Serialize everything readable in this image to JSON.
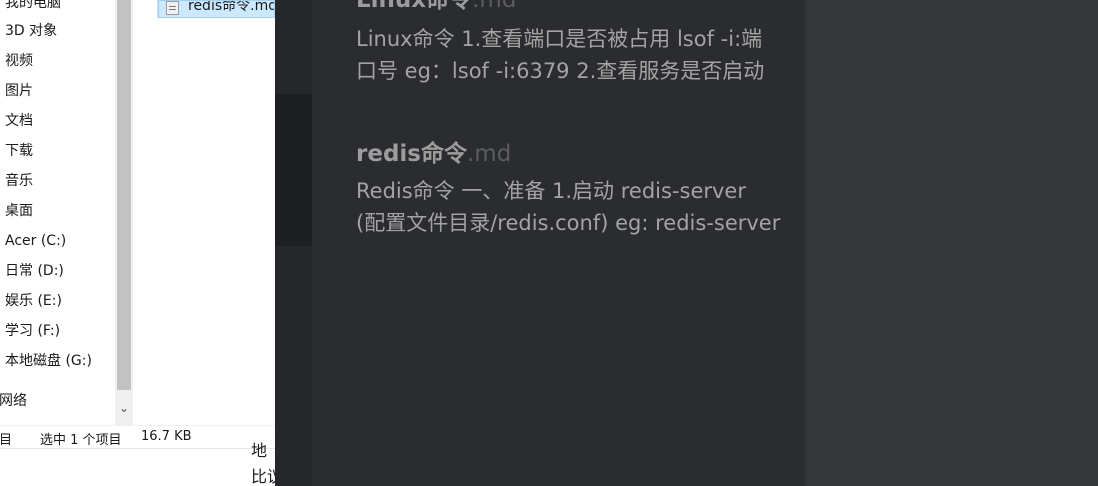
{
  "explorer": {
    "nav_items": [
      {
        "label": "我的电脑",
        "name": "nav-item-this-pc"
      },
      {
        "label": "3D 对象",
        "name": "nav-item-3d-objects"
      },
      {
        "label": "视频",
        "name": "nav-item-videos"
      },
      {
        "label": "图片",
        "name": "nav-item-pictures"
      },
      {
        "label": "文档",
        "name": "nav-item-documents"
      },
      {
        "label": "下载",
        "name": "nav-item-downloads"
      },
      {
        "label": "音乐",
        "name": "nav-item-music"
      },
      {
        "label": "桌面",
        "name": "nav-item-desktop"
      },
      {
        "label": "Acer (C:)",
        "name": "nav-item-drive-c"
      },
      {
        "label": "日常 (D:)",
        "name": "nav-item-drive-d"
      },
      {
        "label": "娱乐 (E:)",
        "name": "nav-item-drive-e"
      },
      {
        "label": "学习 (F:)",
        "name": "nav-item-drive-f"
      },
      {
        "label": "本地磁盘 (G:)",
        "name": "nav-item-drive-g"
      },
      {
        "label": "网络",
        "name": "nav-item-network"
      }
    ],
    "selected_file": "redis命令.md",
    "status": {
      "items_fragment": "目",
      "selection": "选中 1 个项目",
      "size": "16.7 KB"
    },
    "behind_text": [
      "地",
      "比议"
    ]
  },
  "notes": [
    {
      "title": "Linux命令",
      "ext": ".md",
      "lines": [
        "Linux命令 1.查看端口是否被占用 lsof -i:端",
        "口号 eg：lsof -i:6379 2.查看服务是否启动"
      ]
    },
    {
      "title": "redis命令",
      "ext": ".md",
      "lines": [
        "Redis命令 一、准备 1.启动 redis-server",
        "(配置文件目录/redis.conf) eg: redis-server"
      ]
    }
  ],
  "colors": {
    "editor_bg": "#2b2c2f",
    "right_pane_bg": "#353639",
    "selection_bg": "#cce8ff"
  },
  "icons": {
    "file": "markdown-file-icon",
    "scroll_down": "chevron-down-icon"
  }
}
